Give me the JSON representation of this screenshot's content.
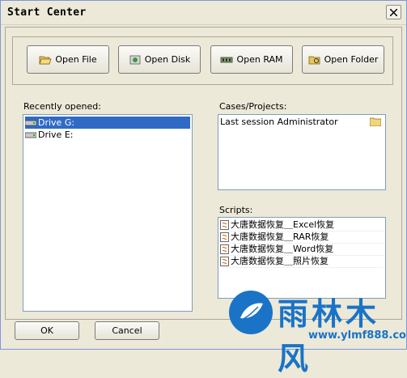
{
  "window": {
    "title": "Start Center"
  },
  "toolbar": {
    "open_file": "Open File",
    "open_disk": "Open Disk",
    "open_ram": "Open RAM",
    "open_folder": "Open Folder"
  },
  "recent": {
    "label": "Recently opened:",
    "items": [
      "Drive G:",
      "Drive E:"
    ]
  },
  "cases": {
    "label": "Cases/Projects:",
    "items": [
      "Last session Administrator"
    ]
  },
  "scripts": {
    "label": "Scripts:",
    "items": [
      "大唐数据恢复＿Excel恢复",
      "大唐数据恢复＿RAR恢复",
      "大唐数据恢复＿Word恢复",
      "大唐数据恢复＿照片恢复"
    ]
  },
  "footer": {
    "ok": "OK",
    "cancel": "Cancel"
  },
  "watermark": {
    "brand": "雨林木风",
    "url": "www.ylmf888.com"
  },
  "colors": {
    "accent": "#316ac5",
    "window_bg": "#ece9d8",
    "logo": "#1a73c7"
  }
}
